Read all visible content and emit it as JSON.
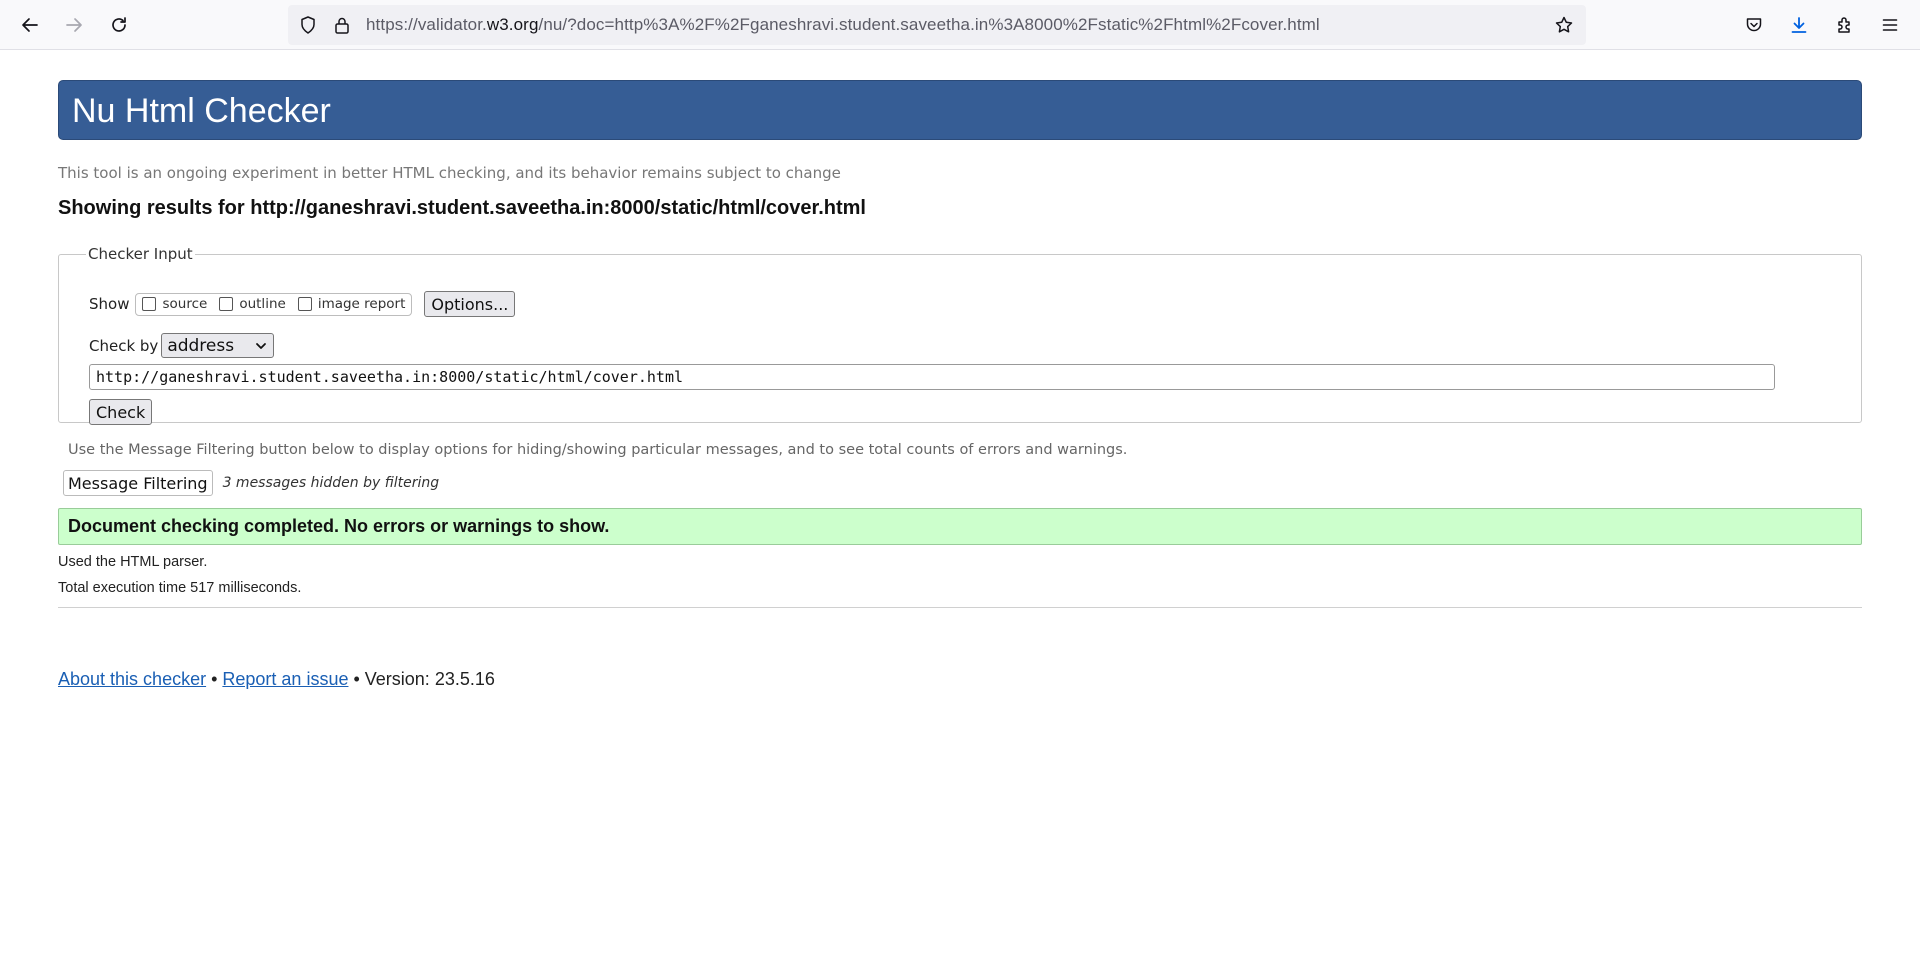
{
  "browser": {
    "url_prefix": "https://validator.",
    "url_domain": "w3.org",
    "url_suffix": "/nu/?doc=http%3A%2F%2Fganeshravi.student.saveetha.in%3A8000%2Fstatic%2Fhtml%2Fcover.html",
    "icons": [
      "back-icon",
      "forward-icon",
      "reload-icon",
      "shield-icon",
      "lock-icon",
      "bookmark-star-icon",
      "pocket-icon",
      "download-icon",
      "extensions-icon",
      "menu-icon"
    ]
  },
  "page": {
    "title": "Nu Html Checker",
    "subtitle": "This tool is an ongoing experiment in better HTML checking, and its behavior remains subject to change",
    "showing_results": "Showing results for http://ganeshravi.student.saveetha.in:8000/static/html/cover.html"
  },
  "checker_input": {
    "legend": "Checker Input",
    "show_label": "Show",
    "options": [
      "source",
      "outline",
      "image report"
    ],
    "options_button": "Options...",
    "check_by_label": "Check by",
    "check_by_value": "address",
    "url_value": "http://ganeshravi.student.saveetha.in:8000/static/html/cover.html",
    "check_button": "Check"
  },
  "filtering": {
    "note": "Use the Message Filtering button below to display options for hiding/showing particular messages, and to see total counts of errors and warnings.",
    "button": "Message Filtering",
    "hidden_count": "3 messages hidden by filtering"
  },
  "results": {
    "status": "Document checking completed. No errors or warnings to show.",
    "parser": "Used the HTML parser.",
    "execution_time": "Total execution time 517 milliseconds."
  },
  "footer": {
    "about_link": "About this checker",
    "sep1": " • ",
    "report_link": "Report an issue",
    "version": " • Version: 23.5.16"
  },
  "colors": {
    "banner": "#365d95",
    "success_bg": "#ccffcc",
    "link": "#1a5fb4"
  }
}
